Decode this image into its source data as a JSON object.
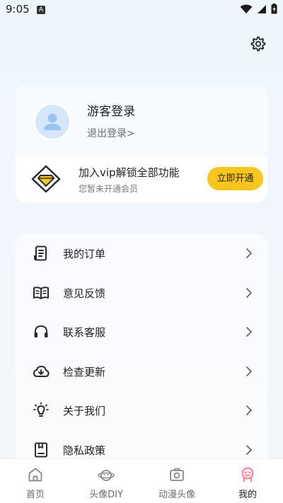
{
  "status_bar": {
    "time": "9:05",
    "notification_letter": "A"
  },
  "profile": {
    "title": "游客登录",
    "logout": "退出登录>"
  },
  "vip": {
    "title": "加入vip解锁全部功能",
    "subtitle": "您暂未开通会员",
    "button": "立即开通",
    "accent": "#f7c61d"
  },
  "menu": {
    "items": [
      {
        "label": "我的订单",
        "icon": "order-icon"
      },
      {
        "label": "意见反馈",
        "icon": "feedback-book-icon"
      },
      {
        "label": "联系客服",
        "icon": "headset-icon"
      },
      {
        "label": "检查更新",
        "icon": "cloud-update-icon"
      },
      {
        "label": "关于我们",
        "icon": "lightbulb-icon"
      },
      {
        "label": "隐私政策",
        "icon": "privacy-doc-icon"
      }
    ]
  },
  "tabs": [
    {
      "label": "首页",
      "icon": "home-icon",
      "active": false
    },
    {
      "label": "头像DIY",
      "icon": "avatar-diy-icon",
      "active": false
    },
    {
      "label": "动漫头像",
      "icon": "anime-avatar-icon",
      "active": false
    },
    {
      "label": "我的",
      "icon": "mine-icon",
      "active": true
    }
  ],
  "colors": {
    "active_tab": "#f27a8a",
    "icon_dark": "#2b2b2b"
  }
}
